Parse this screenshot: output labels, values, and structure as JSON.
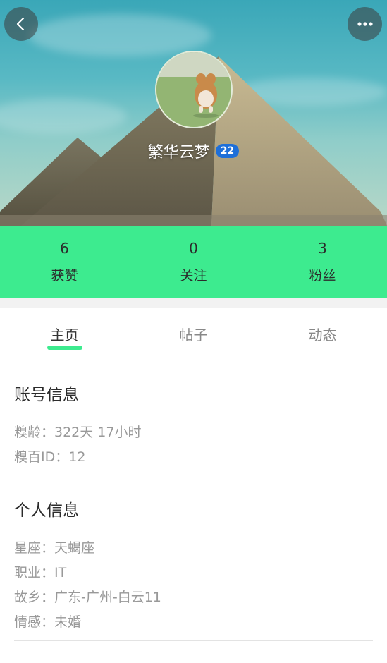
{
  "header": {
    "back_icon": "chevron-left-icon",
    "more_icon": "more-dots-icon",
    "username": "繁华云梦",
    "level": "22"
  },
  "stats": [
    {
      "value": "6",
      "label": "获赞"
    },
    {
      "value": "0",
      "label": "关注"
    },
    {
      "value": "3",
      "label": "粉丝"
    }
  ],
  "tabs": [
    {
      "label": "主页",
      "active": true
    },
    {
      "label": "帖子",
      "active": false
    },
    {
      "label": "动态",
      "active": false
    }
  ],
  "account_info": {
    "title": "账号信息",
    "lines": [
      "糗龄：322天 17小时",
      "糗百ID：12"
    ]
  },
  "personal_info": {
    "title": "个人信息",
    "lines": [
      "星座：天蝎座",
      "职业：IT",
      "故乡：广东-广州-白云11",
      "情感：未婚"
    ]
  },
  "colors": {
    "accent": "#3deb8f",
    "badge": "#1e6fd9"
  }
}
